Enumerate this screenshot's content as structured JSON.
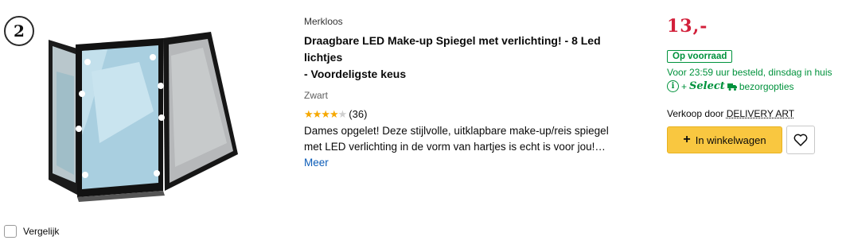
{
  "rank": "2",
  "product": {
    "brand": "Merkloos",
    "title_line1": "Draagbare LED Make-up Spiegel met verlichting! - 8 Led lichtjes",
    "title_line2": "- Voordeligste keus",
    "variant": "Zwart",
    "rating": {
      "stars": 4,
      "max_stars": 5,
      "count_label": "(36)"
    },
    "description_line1": "Dames opgelet! Deze stijlvolle, uitklapbare make-up/reis spiegel",
    "description_line2": "met LED verlichting in de vorm van hartjes is echt is voor jou!…",
    "more_label": "Meer",
    "image_icon": "tri-fold-led-mirror"
  },
  "compare": {
    "label": "Vergelijk"
  },
  "buybox": {
    "price": "13,-",
    "stock_label": "Op voorraad",
    "delivery_text": "Voor 23:59 uur besteld, dinsdag in huis",
    "select_plus": "+",
    "select_label": "Select",
    "select_suffix": "bezorgopties",
    "seller_prefix": "Verkoop door",
    "seller_name": "DELIVERY ART",
    "cart_label": "In winkelwagen",
    "wishlist_icon": "heart-icon"
  },
  "colors": {
    "price": "#d21f3a",
    "stock_green": "#00923c",
    "cart_yellow": "#f9c740",
    "link_blue": "#0b5cb8",
    "star_gold": "#f6a800"
  }
}
